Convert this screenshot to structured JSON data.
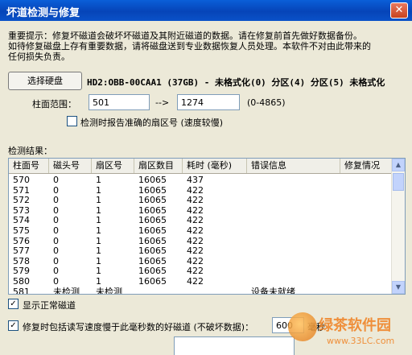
{
  "window": {
    "title": "坏道检测与修复",
    "close_glyph": "✕"
  },
  "notice": {
    "line1": "重要提示：修复坏磁道会破坏坏磁道及其附近磁道的数据。请在修复前首先做好数据备份。",
    "line2": "如待修复磁盘上存有重要数据，请将磁盘送到专业数据恢复人员处理。本软件不对由此带来的",
    "line3": "任何损失负责。"
  },
  "disk": {
    "select_button": "选择硬盘",
    "info": "HD2:OBB-00CAA1 (37GB) - 未格式化(0) 分区(4) 分区(5) 未格式化"
  },
  "cylinder_range": {
    "label": "柱面范围：",
    "start": "501",
    "arrow": "-->",
    "end": "1274",
    "hint": "(0-4865)"
  },
  "report_inaccurate": {
    "checked": false,
    "label": "检测时报告准确的扇区号 (速度较慢)"
  },
  "results": {
    "label": "检测结果：",
    "columns": [
      "柱面号",
      "磁头号",
      "扇区号",
      "扇区数目",
      "耗时 (毫秒)",
      "错误信息",
      "修复情况"
    ],
    "rows": [
      [
        "570",
        "0",
        "1",
        "16065",
        "437",
        "",
        ""
      ],
      [
        "571",
        "0",
        "1",
        "16065",
        "422",
        "",
        ""
      ],
      [
        "572",
        "0",
        "1",
        "16065",
        "422",
        "",
        ""
      ],
      [
        "573",
        "0",
        "1",
        "16065",
        "422",
        "",
        ""
      ],
      [
        "574",
        "0",
        "1",
        "16065",
        "422",
        "",
        ""
      ],
      [
        "575",
        "0",
        "1",
        "16065",
        "422",
        "",
        ""
      ],
      [
        "576",
        "0",
        "1",
        "16065",
        "422",
        "",
        ""
      ],
      [
        "577",
        "0",
        "1",
        "16065",
        "422",
        "",
        ""
      ],
      [
        "578",
        "0",
        "1",
        "16065",
        "422",
        "",
        ""
      ],
      [
        "579",
        "0",
        "1",
        "16065",
        "422",
        "",
        ""
      ],
      [
        "580",
        "0",
        "1",
        "16065",
        "422",
        "",
        ""
      ],
      [
        "581",
        "未检测",
        "未检测",
        "",
        "",
        "设备未就绪",
        ""
      ]
    ]
  },
  "show_normal": {
    "checked": true,
    "label": "显示正常磁道"
  },
  "repair_slow": {
    "checked": true,
    "label": "修复时包括读写速度慢于此毫秒数的好磁道 (不破坏数据)：",
    "value": "600",
    "unit": "毫秒"
  },
  "watermark": {
    "text": "绿茶软件园",
    "url": "www.33LC.com"
  }
}
